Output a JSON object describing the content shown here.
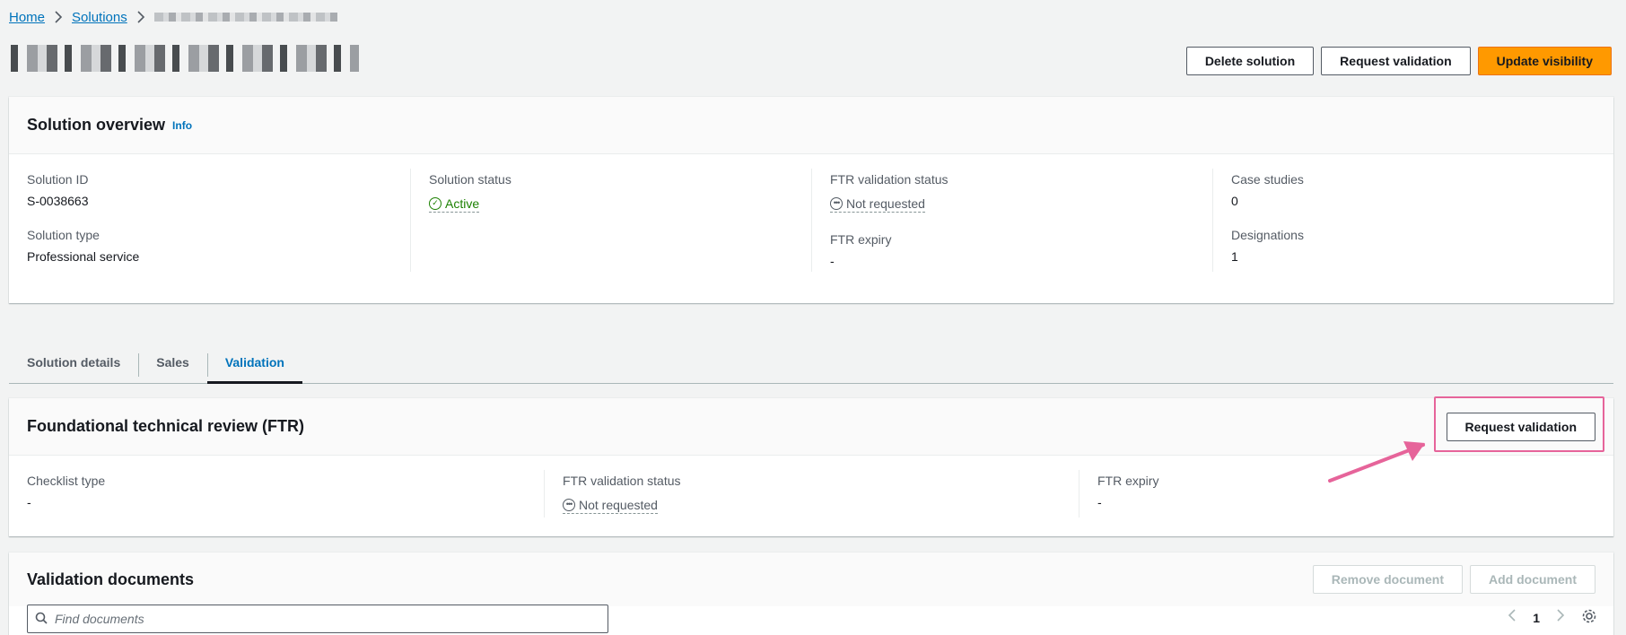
{
  "breadcrumb": {
    "items": [
      {
        "label": "Home"
      },
      {
        "label": "Solutions"
      }
    ]
  },
  "header": {
    "actions": {
      "delete": "Delete solution",
      "request": "Request validation",
      "update": "Update visibility"
    }
  },
  "overview": {
    "title": "Solution overview",
    "info": "Info",
    "solution_id_label": "Solution ID",
    "solution_id_value": "S-0038663",
    "solution_type_label": "Solution type",
    "solution_type_value": "Professional service",
    "solution_status_label": "Solution status",
    "solution_status_value": "Active",
    "ftr_status_label": "FTR validation status",
    "ftr_status_value": "Not requested",
    "ftr_expiry_label": "FTR expiry",
    "ftr_expiry_value": "-",
    "case_studies_label": "Case studies",
    "case_studies_value": "0",
    "designations_label": "Designations",
    "designations_value": "1"
  },
  "tabs": [
    {
      "label": "Solution details"
    },
    {
      "label": "Sales"
    },
    {
      "label": "Validation"
    }
  ],
  "ftr": {
    "title": "Foundational technical review (FTR)",
    "request_button": "Request validation",
    "checklist_label": "Checklist type",
    "checklist_value": "-",
    "status_label": "FTR validation status",
    "status_value": "Not requested",
    "expiry_label": "FTR expiry",
    "expiry_value": "-"
  },
  "docs": {
    "title": "Validation documents",
    "remove": "Remove document",
    "add": "Add document",
    "search_placeholder": "Find documents",
    "page": "1"
  },
  "colors": {
    "primary": "#ff9900",
    "link": "#0073bb",
    "success": "#1d8102",
    "highlight": "#e6649a"
  }
}
